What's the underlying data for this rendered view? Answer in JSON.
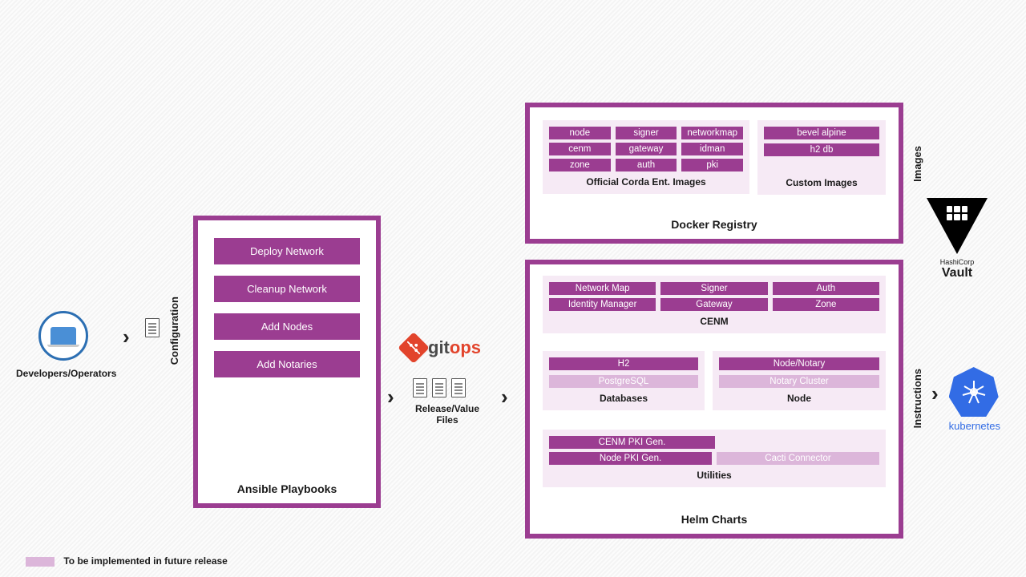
{
  "actors": {
    "developers": "Developers/Operators"
  },
  "labels": {
    "configuration": "Configuration",
    "release_files": "Release/Value Files",
    "images": "Images",
    "instructions": "Instructions"
  },
  "ansible": {
    "title": "Ansible Playbooks",
    "items": [
      "Deploy Network",
      "Cleanup Network",
      "Add Nodes",
      "Add Notaries"
    ]
  },
  "gitops": {
    "git": "git",
    "ops": "ops"
  },
  "docker": {
    "title": "Docker Registry",
    "official": {
      "title": "Official Corda Ent. Images",
      "rows": [
        [
          "node",
          "signer",
          "networkmap"
        ],
        [
          "cenm",
          "gateway",
          "idman"
        ],
        [
          "zone",
          "auth",
          "pki"
        ]
      ]
    },
    "custom": {
      "title": "Custom Images",
      "items": [
        "bevel alpine",
        "h2 db"
      ]
    }
  },
  "helm": {
    "title": "Helm Charts",
    "cenm": {
      "title": "CENM",
      "rows": [
        [
          "Network Map",
          "Signer",
          "Auth"
        ],
        [
          "Identity Manager",
          "Gateway",
          "Zone"
        ]
      ]
    },
    "databases": {
      "title": "Databases",
      "items": [
        {
          "label": "H2",
          "future": false
        },
        {
          "label": "PostgreSQL",
          "future": true
        }
      ]
    },
    "node": {
      "title": "Node",
      "items": [
        {
          "label": "Node/Notary",
          "future": false
        },
        {
          "label": "Notary Cluster",
          "future": true
        }
      ]
    },
    "utilities": {
      "title": "Utilities",
      "items": [
        {
          "label": "CENM PKI Gen.",
          "future": false
        },
        {
          "label": "Node PKI Gen.",
          "future": false
        },
        {
          "label": "Cacti Connector",
          "future": true
        }
      ]
    }
  },
  "external": {
    "vault_top": "HashiCorp",
    "vault": "Vault",
    "k8s": "kubernetes"
  },
  "legend": "To be implemented in future release"
}
